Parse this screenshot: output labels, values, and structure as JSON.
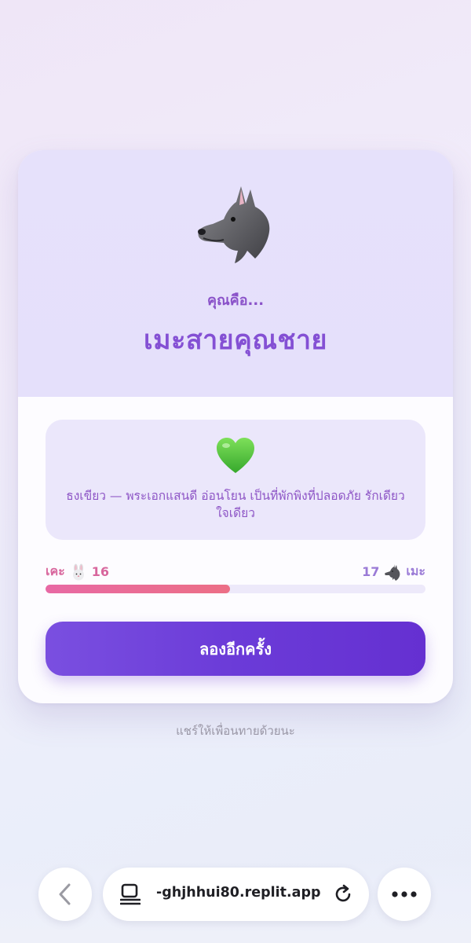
{
  "result": {
    "subtitle": "คุณคือ...",
    "title": "เมะสายคุณชาย",
    "avatar_icon": "wolf-icon",
    "description_icon": "green-heart-icon",
    "description": "ธงเขียว — พระเอกแสนดี อ่อนโยน เป็นที่พักพิงที่ปลอดภัย รักเดียวใจเดียว"
  },
  "score": {
    "left_label": "เคะ",
    "left_icon": "rabbit-icon",
    "left_value": "16",
    "right_value": "17",
    "right_icon": "wolf-icon",
    "right_label": "เมะ",
    "left_ratio": 0.485,
    "bar_color_left": "#e869a4",
    "bar_color_right": "#ec6f86"
  },
  "actions": {
    "retry_label": "ลองอีกครั้ง",
    "share_text": "แชร์ให้เพื่อนทายด้วยนะ"
  },
  "browser": {
    "url": "-ghjhhui80.replit.app"
  },
  "colors": {
    "accent": "#6b3bd8",
    "title": "#8450d4"
  }
}
